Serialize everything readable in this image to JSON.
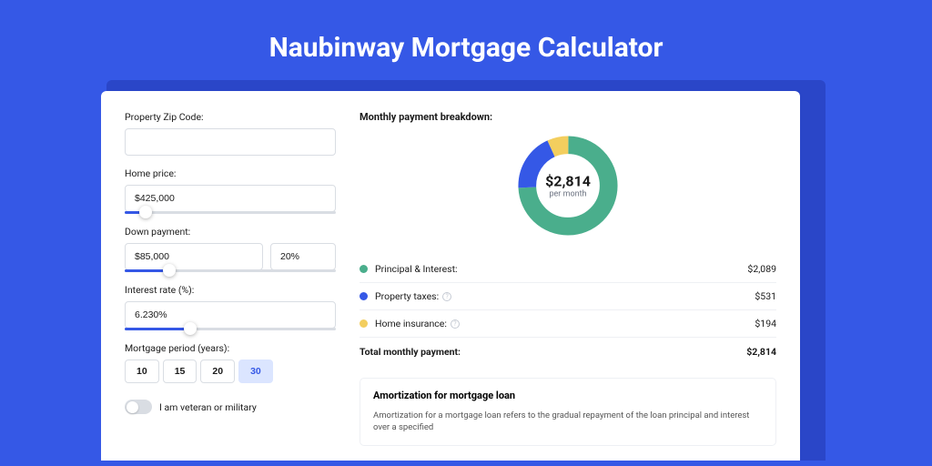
{
  "title": "Naubinway Mortgage Calculator",
  "form": {
    "zip_label": "Property Zip Code:",
    "zip_value": "",
    "home_price_label": "Home price:",
    "home_price_value": "$425,000",
    "down_payment_label": "Down payment:",
    "down_payment_value": "$85,000",
    "down_payment_pct": "20%",
    "interest_label": "Interest rate (%):",
    "interest_value": "6.230%",
    "period_label": "Mortgage period (years):",
    "periods": [
      "10",
      "15",
      "20",
      "30"
    ],
    "period_active": 3,
    "veteran_label": "I am veteran or military"
  },
  "breakdown": {
    "title": "Monthly payment breakdown:",
    "center_amount": "$2,814",
    "center_sub": "per month",
    "rows": [
      {
        "label": "Principal & Interest:",
        "value": "$2,089",
        "color": "#4aae8c",
        "info": false
      },
      {
        "label": "Property taxes:",
        "value": "$531",
        "color": "#3558e6",
        "info": true
      },
      {
        "label": "Home insurance:",
        "value": "$194",
        "color": "#f3ce5e",
        "info": true
      }
    ],
    "total_label": "Total monthly payment:",
    "total_value": "$2,814"
  },
  "chart_data": {
    "type": "pie",
    "title": "Monthly payment breakdown",
    "series": [
      {
        "name": "Principal & Interest",
        "value": 2089,
        "color": "#4aae8c"
      },
      {
        "name": "Property taxes",
        "value": 531,
        "color": "#3558e6"
      },
      {
        "name": "Home insurance",
        "value": 194,
        "color": "#f3ce5e"
      }
    ],
    "center": "$2,814 per month"
  },
  "amort": {
    "title": "Amortization for mortgage loan",
    "text": "Amortization for a mortgage loan refers to the gradual repayment of the loan principal and interest over a specified"
  }
}
